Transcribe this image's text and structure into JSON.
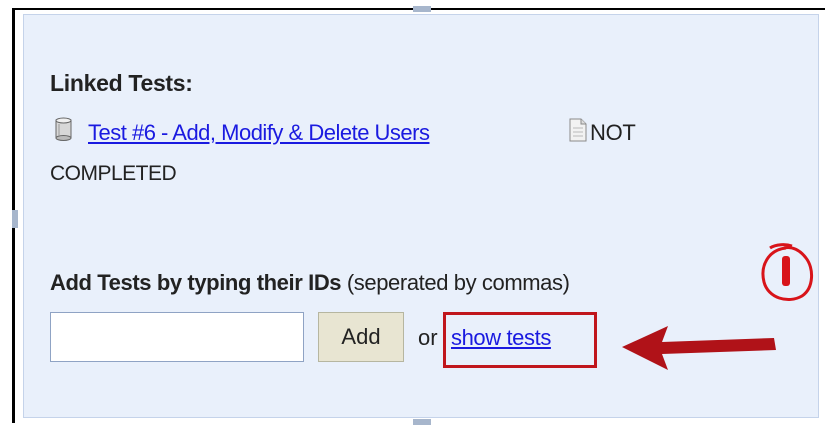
{
  "linked_tests": {
    "heading": "Linked Tests:",
    "items": [
      {
        "name": "Test #6 - Add, Modify & Delete Users",
        "status_line1": "NOT",
        "status_line2": "COMPLETED"
      }
    ]
  },
  "add_tests": {
    "label_bold": "Add Tests by typing their IDs",
    "label_hint": "(seperated by commas)",
    "input_value": "",
    "add_button": "Add",
    "or_text": "or",
    "show_tests_link": "show tests"
  },
  "annotations": {
    "marker_color": "#c0161c",
    "highlight_color": "#c0161c"
  },
  "icons": {
    "test_icon": "database-icon",
    "status_icon": "document-icon",
    "annotation_arrow": "arrow-left-icon",
    "annotation_marker": "exclamation-icon"
  }
}
